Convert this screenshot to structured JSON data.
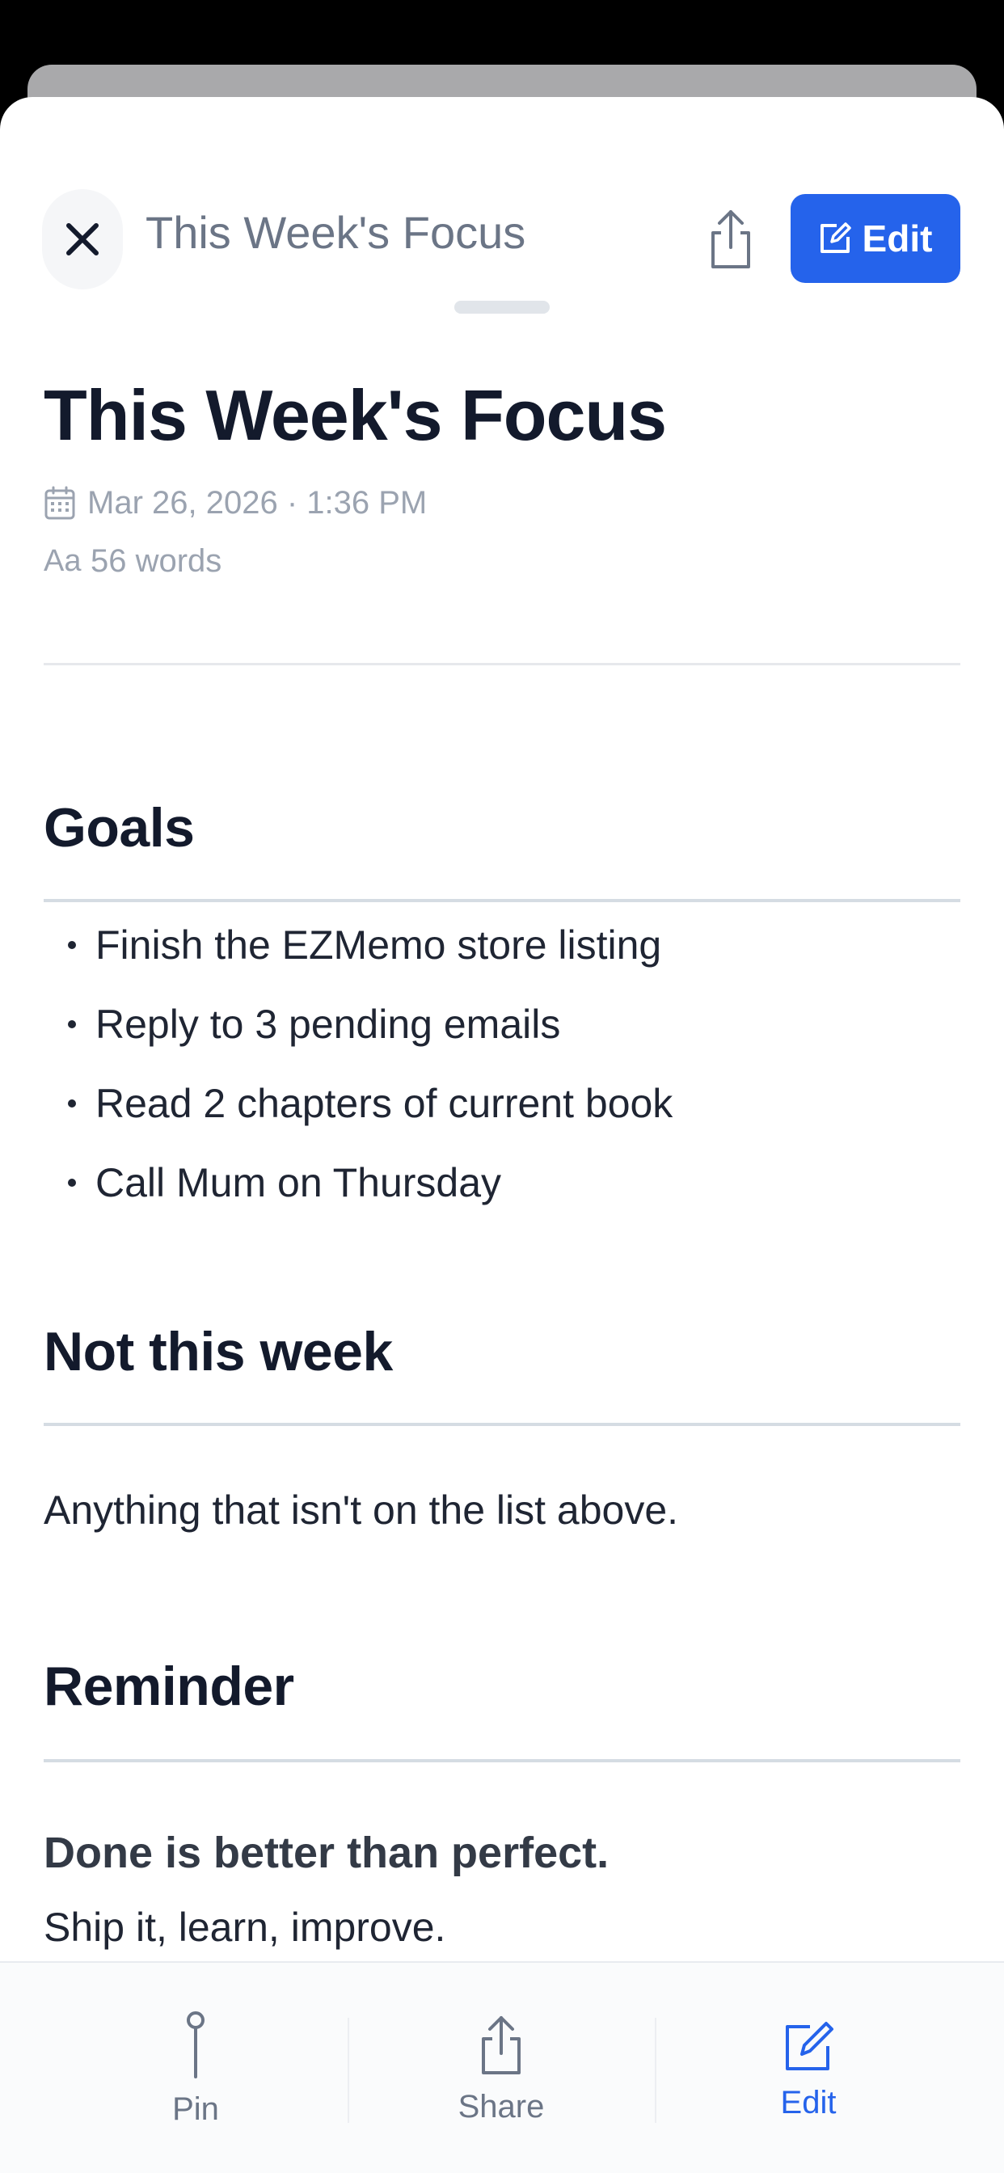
{
  "header": {
    "title": "This Week's Focus",
    "edit_label": "Edit"
  },
  "note": {
    "title": "This Week's Focus",
    "date": "Mar 26, 2026 · 1:36 PM",
    "word_count": "56 words",
    "word_icon_text": "Aa",
    "sections": [
      {
        "heading": "Goals",
        "items": [
          "Finish the EZMemo store listing",
          "Reply to 3 pending emails",
          "Read 2 chapters of current book",
          "Call Mum on Thursday"
        ]
      },
      {
        "heading": "Not this week",
        "text": "Anything that isn't on the list above."
      },
      {
        "heading": "Reminder",
        "bold_text": "Done is better than perfect.",
        "text": "Ship it, learn, improve."
      }
    ]
  },
  "toolbar": {
    "pin_label": "Pin",
    "share_label": "Share",
    "edit_label": "Edit"
  },
  "colors": {
    "accent": "#2563eb",
    "title_text": "#131a2c",
    "muted_text": "#6b7586"
  },
  "icons": [
    "close-icon",
    "share-icon",
    "edit-icon",
    "calendar-icon",
    "pin-icon"
  ]
}
